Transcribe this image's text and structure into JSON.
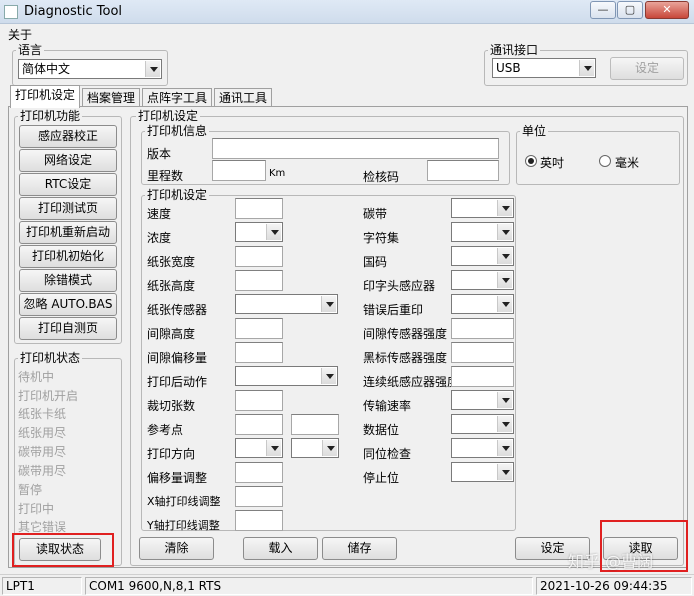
{
  "window": {
    "title": "Diagnostic Tool",
    "controls": {
      "minimize": "—",
      "maximize": "▢",
      "close": "✕"
    }
  },
  "menu": {
    "about": "关于"
  },
  "language": {
    "group_label": "语言",
    "value": "简体中文"
  },
  "comm": {
    "group_label": "通讯接口",
    "value": "USB",
    "set_button": "设定"
  },
  "tabs": [
    "打印机设定",
    "档案管理",
    "点阵字工具",
    "通讯工具"
  ],
  "printer_functions": {
    "group_label": "打印机功能",
    "buttons": [
      "感应器校正",
      "网络设定",
      "RTC设定",
      "打印测试页",
      "打印机重新启动",
      "打印机初始化",
      "除错模式",
      "忽略 AUTO.BAS",
      "打印自测页"
    ]
  },
  "printer_status": {
    "group_label": "打印机状态",
    "items": [
      "待机中",
      "打印机开启",
      "纸张卡纸",
      "纸张用尽",
      "碳带用尽",
      "碳带用尽",
      "暂停",
      "打印中",
      "其它错误"
    ],
    "read_button": "读取状态"
  },
  "printer_settings": {
    "group_label": "打印机设定",
    "info": {
      "group_label": "打印机信息",
      "version_label": "版本",
      "mileage_label": "里程数",
      "mileage_unit": "Km",
      "checksum_label": "检核码"
    },
    "unit": {
      "group_label": "单位",
      "inch": "英吋",
      "mm": "毫米",
      "selected": "inch"
    },
    "settings": {
      "group_label": "打印机设定",
      "left_labels": [
        "速度",
        "浓度",
        "纸张宽度",
        "纸张高度",
        "纸张传感器",
        "间隙高度",
        "间隙偏移量",
        "打印后动作",
        "裁切张数",
        "参考点",
        "打印方向",
        "偏移量调整",
        "X轴打印线调整",
        "Y轴打印线调整"
      ],
      "right_labels": [
        "碳带",
        "字符集",
        "国码",
        "印字头感应器",
        "错误后重印",
        "间隙传感器强度",
        "黑标传感器强度",
        "连续纸感应器强度",
        "传输速率",
        "数据位",
        "同位检查",
        "停止位"
      ]
    },
    "buttons": {
      "clear": "清除",
      "load": "载入",
      "save": "储存",
      "set": "设定",
      "read": "读取"
    }
  },
  "statusbar": {
    "port": "LPT1",
    "com": "COM1 9600,N,8,1 RTS",
    "datetime": "2021-10-26 09:44:35"
  },
  "watermark": "知乎 @曹阔",
  "colors": {
    "highlight_box": "#e02020",
    "disabled_text": "#a0a0a0"
  }
}
